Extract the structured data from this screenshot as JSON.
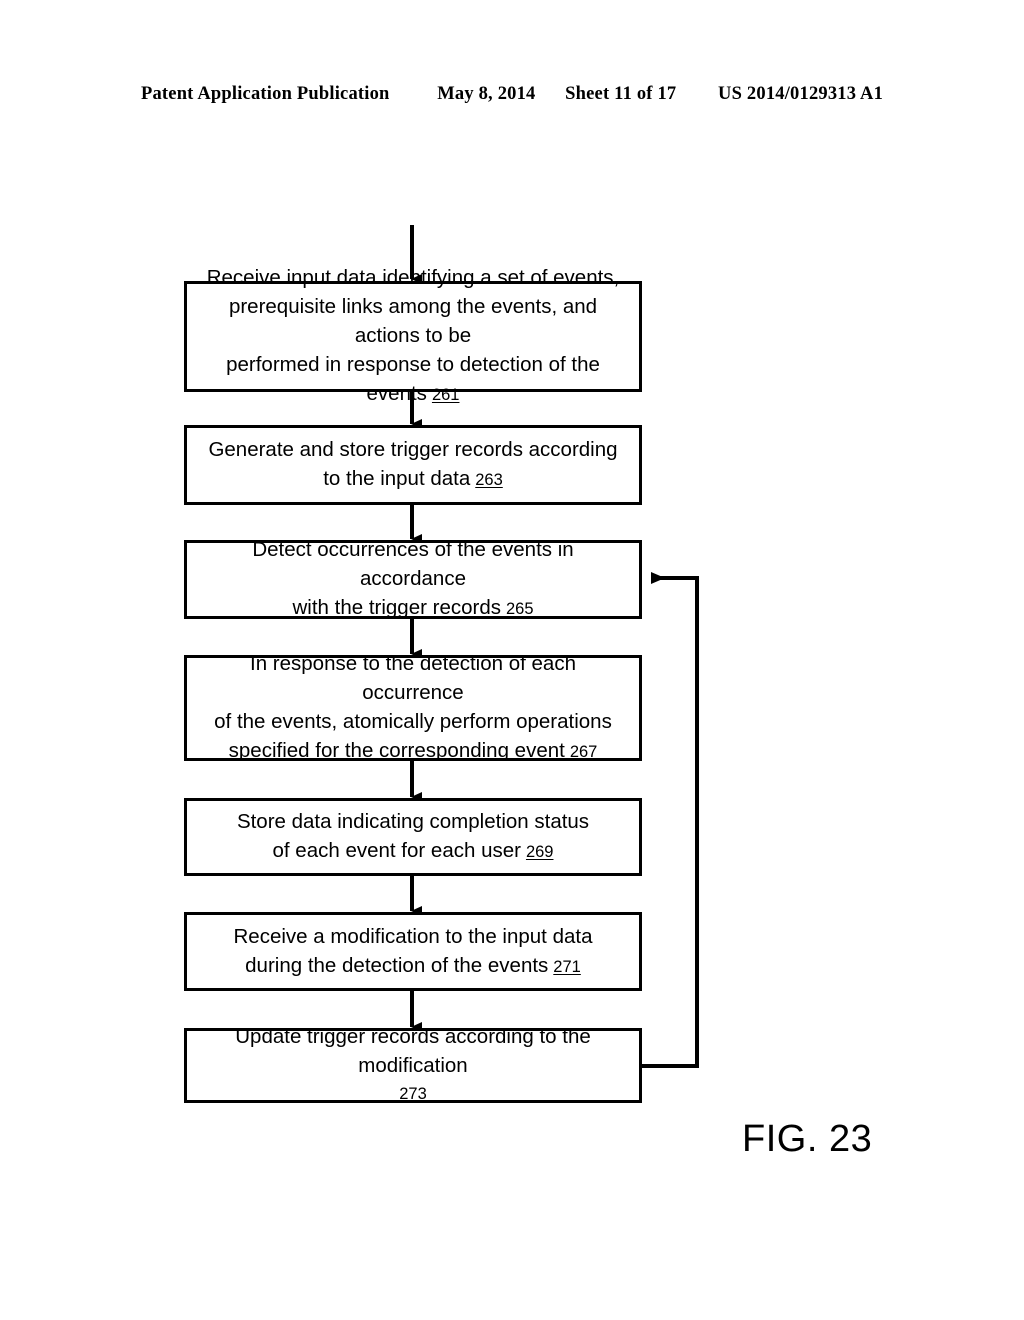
{
  "header": {
    "publication": "Patent Application Publication",
    "date": "May 8, 2014",
    "sheet": "Sheet 11 of 17",
    "docnum": "US 2014/0129313 A1"
  },
  "figure": {
    "label": "FIG. 23"
  },
  "flowchart": {
    "type": "flowchart",
    "orientation": "vertical",
    "nodes": [
      {
        "id": "261",
        "ref": "261",
        "lines": [
          "Receive input data identifying a set of events,",
          "prerequisite links among the events, and actions to be",
          "performed in response to detection of the events"
        ],
        "ref_inline": true
      },
      {
        "id": "263",
        "ref": "263",
        "lines": [
          "Generate and store trigger records according",
          "to the input data"
        ],
        "ref_inline": true
      },
      {
        "id": "265",
        "ref": "265",
        "lines": [
          "Detect occurrences of the events in accordance",
          "with the trigger records"
        ],
        "ref_inline": true
      },
      {
        "id": "267",
        "ref": "267",
        "lines": [
          "In response to the detection of each occurrence",
          "of the events, atomically perform operations",
          "specified for the corresponding event"
        ],
        "ref_inline": true
      },
      {
        "id": "269",
        "ref": "269",
        "lines": [
          "Store data indicating completion status",
          "of each event for each user"
        ],
        "ref_inline": true
      },
      {
        "id": "271",
        "ref": "271",
        "lines": [
          "Receive a modification to the input data",
          "during the detection of the events"
        ],
        "ref_inline": true
      },
      {
        "id": "273",
        "ref": "273",
        "lines": [
          "Update trigger records according to the modification"
        ],
        "ref_inline": false
      }
    ],
    "edges": [
      {
        "from": "entry",
        "to": "261",
        "style": "arrow-down"
      },
      {
        "from": "261",
        "to": "263",
        "style": "arrow-down"
      },
      {
        "from": "263",
        "to": "265",
        "style": "arrow-down"
      },
      {
        "from": "265",
        "to": "267",
        "style": "arrow-down"
      },
      {
        "from": "267",
        "to": "269",
        "style": "arrow-down"
      },
      {
        "from": "269",
        "to": "271",
        "style": "arrow-down"
      },
      {
        "from": "271",
        "to": "273",
        "style": "arrow-down"
      },
      {
        "from": "273",
        "to": "265",
        "style": "feedback-right-loop"
      }
    ]
  },
  "colors": {
    "ink": "#000000",
    "paper": "#ffffff"
  }
}
